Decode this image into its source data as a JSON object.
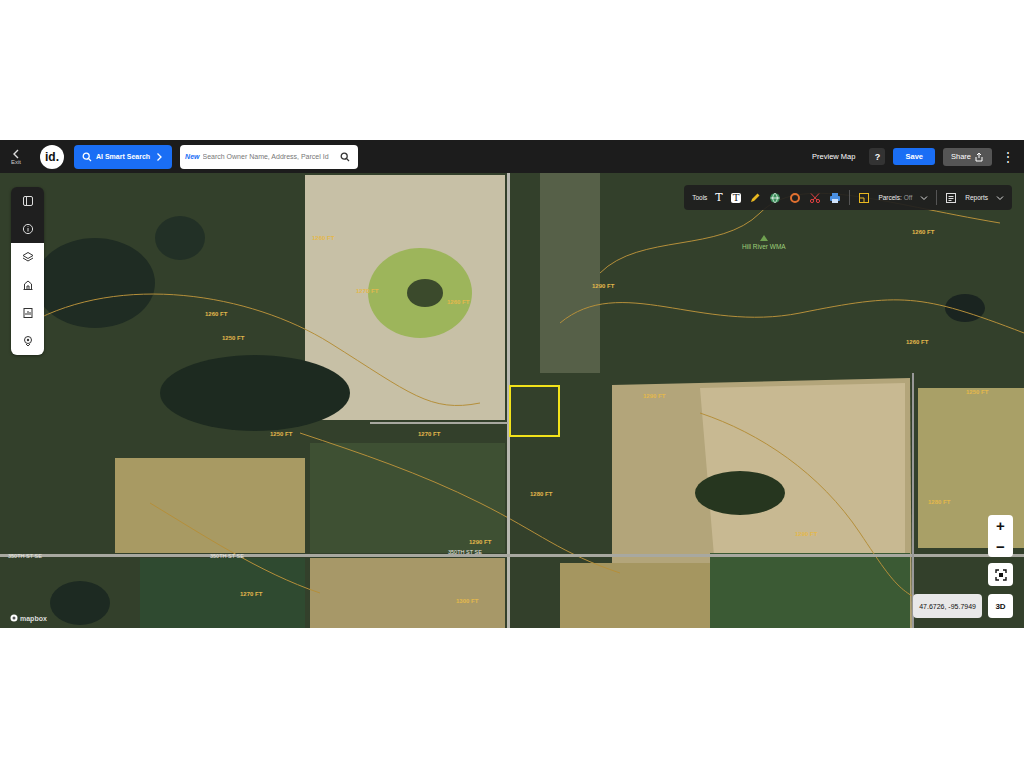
{
  "topbar": {
    "exit_label": "Exit",
    "logo": "id.",
    "ai_search": "AI Smart Search",
    "search": {
      "badge": "New",
      "placeholder": "Search Owner Name, Address, Parcel Id"
    },
    "preview": "Preview Map",
    "help": "?",
    "save": "Save",
    "share": "Share",
    "more": "⋮"
  },
  "map_tools": {
    "label": "Tools",
    "text_tool": "T",
    "text_box_tool": "T",
    "parcels": {
      "label": "Parcels:",
      "value": "Off",
      "on": false
    },
    "reports": "Reports"
  },
  "map": {
    "contour_labels": [
      "1260 FT",
      "1270 FT",
      "1260 FT",
      "1260 FT",
      "1250 FT",
      "1250 FT",
      "1270 FT",
      "1290 FT",
      "1290 FT",
      "1260 FT",
      "1260 FT",
      "1250 FT",
      "1280 FT",
      "1290 FT",
      "1290 FT",
      "1280 FT",
      "1270 FT",
      "1300 FT"
    ],
    "road_labels": [
      "350TH ST SE",
      "350TH ST SE",
      "350TH ST SE"
    ],
    "poi": "Hill River WMA",
    "parcel_selected": true
  },
  "controls": {
    "zoom_in": "+",
    "zoom_out": "−",
    "view_3d": "3D",
    "coordinates": "47.6726, -95.7949",
    "attribution": "mapbox"
  }
}
